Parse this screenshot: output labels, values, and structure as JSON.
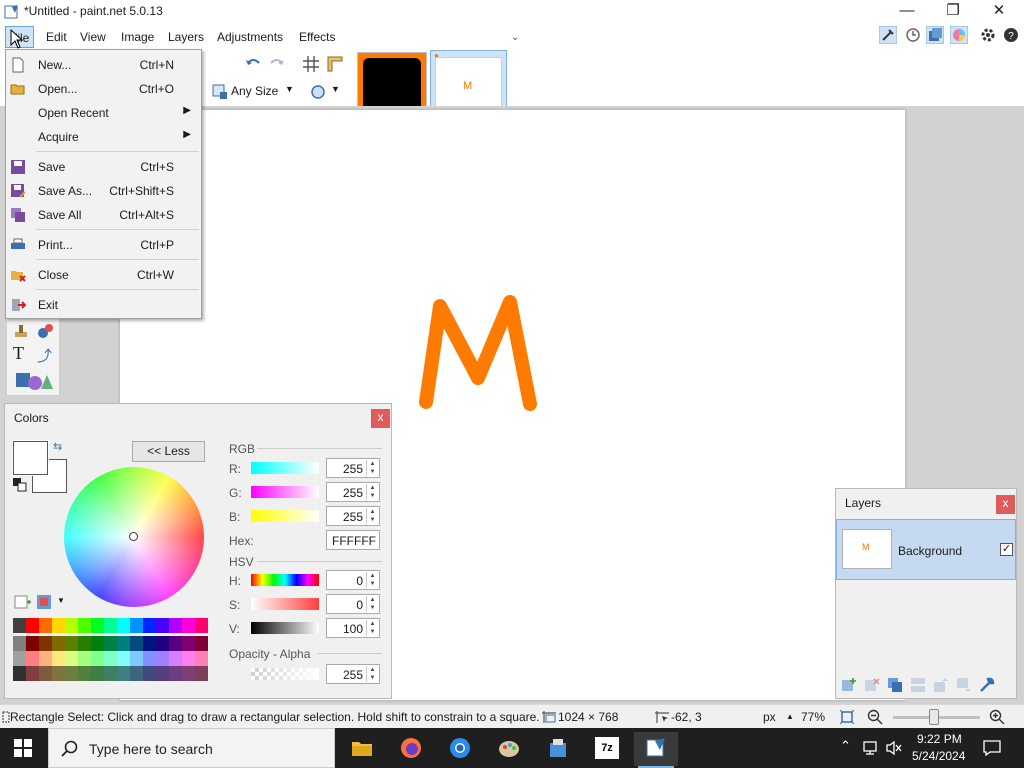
{
  "window": {
    "title": "*Untitled - paint.net 5.0.13",
    "minimize": "—",
    "restore": "❐",
    "close": "✕"
  },
  "menu": [
    "File",
    "Edit",
    "View",
    "Image",
    "Layers",
    "Adjustments",
    "Effects"
  ],
  "toolbar": {
    "brush_size_label": "Any Size",
    "thumb_text": "M"
  },
  "file_menu": {
    "items": [
      {
        "label": "New...",
        "shortcut": "Ctrl+N",
        "icon": "new-file-icon"
      },
      {
        "label": "Open...",
        "shortcut": "Ctrl+O",
        "icon": "open-folder-icon"
      },
      {
        "label": "Open Recent",
        "shortcut": "",
        "submenu": true
      },
      {
        "label": "Acquire",
        "shortcut": "",
        "submenu": true
      },
      {
        "label": "Save",
        "shortcut": "Ctrl+S",
        "icon": "save-icon"
      },
      {
        "label": "Save As...",
        "shortcut": "Ctrl+Shift+S",
        "icon": "save-as-icon"
      },
      {
        "label": "Save All",
        "shortcut": "Ctrl+Alt+S",
        "icon": "save-all-icon"
      },
      {
        "label": "Print...",
        "shortcut": "Ctrl+P",
        "icon": "printer-icon"
      },
      {
        "label": "Close",
        "shortcut": "Ctrl+W",
        "icon": "close-file-icon"
      },
      {
        "label": "Exit",
        "shortcut": "",
        "icon": "exit-icon"
      }
    ]
  },
  "canvas": {
    "drawing_text": "M",
    "drawing_color": "#ff7a00"
  },
  "colors_panel": {
    "title": "Colors",
    "close": "x",
    "less_button": "<< Less",
    "rgb_label": "RGB",
    "r_label": "R:",
    "g_label": "G:",
    "b_label": "B:",
    "r": "255",
    "g": "255",
    "b": "255",
    "hex_label": "Hex:",
    "hex": "FFFFFF",
    "hsv_label": "HSV",
    "h_label": "H:",
    "s_label": "S:",
    "v_label": "V:",
    "h": "0",
    "s": "0",
    "v": "100",
    "alpha_label": "Opacity - Alpha",
    "alpha": "255",
    "palette": [
      [
        "#404040",
        "#ff0000",
        "#ff6a00",
        "#ffd800",
        "#b6ff00",
        "#4cff00",
        "#00ff21",
        "#00ff90",
        "#00ffff",
        "#0094ff",
        "#0026ff",
        "#4800ff",
        "#b200ff",
        "#ff00dc",
        "#ff006e"
      ],
      [
        "#808080",
        "#7f0000",
        "#7f3300",
        "#7f6a00",
        "#5b7f00",
        "#267f00",
        "#007f0e",
        "#007f46",
        "#007f7f",
        "#004a7f",
        "#00137f",
        "#21007f",
        "#57007f",
        "#7f006e",
        "#7f0037"
      ],
      [
        "#a0a0a0",
        "#ff7f7f",
        "#ffb27f",
        "#ffe97f",
        "#daff7f",
        "#a5ff7f",
        "#7fff8e",
        "#7fffc5",
        "#7fffff",
        "#7fc9ff",
        "#7f92ff",
        "#a17fff",
        "#d67fff",
        "#ff7fed",
        "#ff7fb6"
      ],
      [
        "#303030",
        "#7f3f3f",
        "#7f5b3f",
        "#7f743f",
        "#6d7f3f",
        "#527f3f",
        "#3f7f47",
        "#3f7f62",
        "#3f7f7f",
        "#3f647f",
        "#3f497f",
        "#573f7f",
        "#6b3f7f",
        "#7f3f76",
        "#7f3f5b"
      ]
    ]
  },
  "layers_panel": {
    "title": "Layers",
    "close": "x",
    "layer_name": "Background",
    "thumb_text": "M"
  },
  "statusbar": {
    "hint": "Rectangle Select: Click and drag to draw a rectangular selection. Hold shift to constrain to a square.",
    "image_size": "1024 × 768",
    "cursor_pos": "-62, 3",
    "units": "px",
    "zoom": "77%"
  },
  "taskbar": {
    "search_placeholder": "Type here to search",
    "time": "9:22 PM",
    "date": "5/24/2024"
  }
}
